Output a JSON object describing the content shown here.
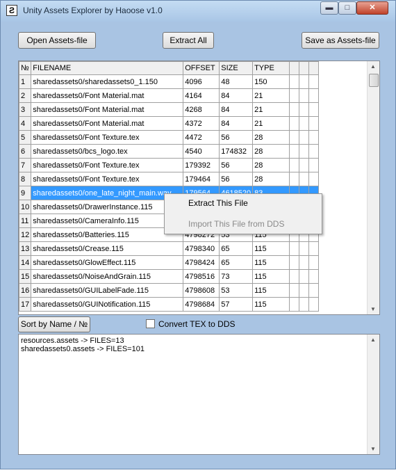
{
  "window": {
    "title": "Unity Assets Explorer by Haoose v1.0",
    "icon_letter": "Ƨ"
  },
  "toolbar": {
    "open_label": "Open Assets-file",
    "extract_all_label": "Extract All",
    "save_label": "Save as Assets-file"
  },
  "table": {
    "headers": {
      "num": "№",
      "filename": "FILENAME",
      "offset": "OFFSET",
      "size": "SIZE",
      "type": "TYPE"
    },
    "rows": [
      {
        "num": "1",
        "filename": "sharedassets0/sharedassets0_1.150",
        "offset": "4096",
        "size": "48",
        "type": "150"
      },
      {
        "num": "2",
        "filename": "sharedassets0/Font Material.mat",
        "offset": "4164",
        "size": "84",
        "type": "21"
      },
      {
        "num": "3",
        "filename": "sharedassets0/Font Material.mat",
        "offset": "4268",
        "size": "84",
        "type": "21"
      },
      {
        "num": "4",
        "filename": "sharedassets0/Font Material.mat",
        "offset": "4372",
        "size": "84",
        "type": "21"
      },
      {
        "num": "5",
        "filename": "sharedassets0/Font Texture.tex",
        "offset": "4472",
        "size": "56",
        "type": "28"
      },
      {
        "num": "6",
        "filename": "sharedassets0/bcs_logo.tex",
        "offset": "4540",
        "size": "174832",
        "type": "28"
      },
      {
        "num": "7",
        "filename": "sharedassets0/Font Texture.tex",
        "offset": "179392",
        "size": "56",
        "type": "28"
      },
      {
        "num": "8",
        "filename": "sharedassets0/Font Texture.tex",
        "offset": "179464",
        "size": "56",
        "type": "28"
      },
      {
        "num": "9",
        "filename": "sharedassets0/one_late_night_main.wav",
        "offset": "179564",
        "size": "4618520",
        "type": "83"
      },
      {
        "num": "10",
        "filename": "sharedassets0/DrawerInstance.115",
        "offset": "",
        "size": "",
        "type": ""
      },
      {
        "num": "11",
        "filename": "sharedassets0/CameraInfo.115",
        "offset": "",
        "size": "",
        "type": ""
      },
      {
        "num": "12",
        "filename": "sharedassets0/Batteries.115",
        "offset": "4798272",
        "size": "53",
        "type": "115"
      },
      {
        "num": "13",
        "filename": "sharedassets0/Crease.115",
        "offset": "4798340",
        "size": "65",
        "type": "115"
      },
      {
        "num": "14",
        "filename": "sharedassets0/GlowEffect.115",
        "offset": "4798424",
        "size": "65",
        "type": "115"
      },
      {
        "num": "15",
        "filename": "sharedassets0/NoiseAndGrain.115",
        "offset": "4798516",
        "size": "73",
        "type": "115"
      },
      {
        "num": "16",
        "filename": "sharedassets0/GUILabelFade.115",
        "offset": "4798608",
        "size": "53",
        "type": "115"
      },
      {
        "num": "17",
        "filename": "sharedassets0/GUINotification.115",
        "offset": "4798684",
        "size": "57",
        "type": "115"
      }
    ]
  },
  "context_menu": {
    "extract_label": "Extract This File",
    "import_label": "Import This File from DDS"
  },
  "controls": {
    "sort_label": "Sort by Name / №",
    "convert_label": "Convert TEX to DDS",
    "convert_checked": false
  },
  "log": {
    "lines": [
      "resources.assets -> FILES=13",
      "sharedassets0.assets -> FILES=101"
    ]
  },
  "colors": {
    "selection": "#3399ff",
    "frame": "#a9c4e3",
    "close_button": "#c0432b"
  }
}
